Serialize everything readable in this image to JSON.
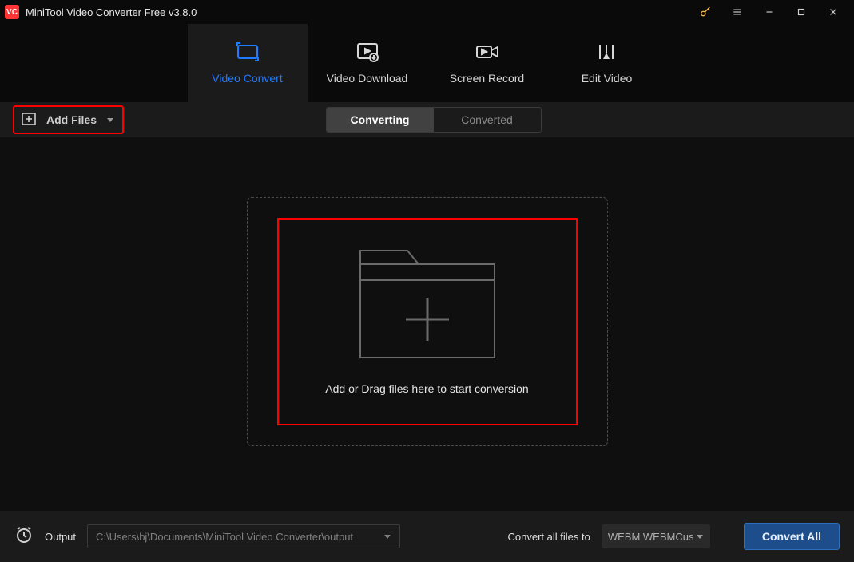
{
  "titlebar": {
    "logo_text": "VC",
    "title": "MiniTool Video Converter Free v3.8.0"
  },
  "nav": {
    "tabs": [
      {
        "label": "Video Convert",
        "active": true
      },
      {
        "label": "Video Download",
        "active": false
      },
      {
        "label": "Screen Record",
        "active": false
      },
      {
        "label": "Edit Video",
        "active": false
      }
    ]
  },
  "toolbar": {
    "add_files_label": "Add Files"
  },
  "status_tabs": {
    "converting": "Converting",
    "converted": "Converted"
  },
  "dropzone": {
    "text": "Add or Drag files here to start conversion"
  },
  "footer": {
    "output_label": "Output",
    "output_path": "C:\\Users\\bj\\Documents\\MiniTool Video Converter\\output",
    "convert_all_to_label": "Convert all files to",
    "format_selected": "WEBM WEBMCus",
    "convert_all_button": "Convert All"
  },
  "colors": {
    "accent_blue": "#1f7bff",
    "highlight_red": "#ff0000",
    "button_blue": "#1d4d8a"
  }
}
